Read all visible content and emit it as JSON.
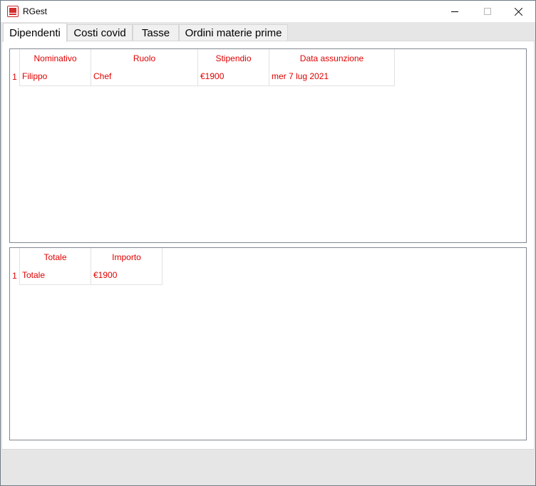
{
  "window": {
    "title": "RGest",
    "icon": "app-icon"
  },
  "tabs": [
    {
      "label": "Dipendenti",
      "active": true
    },
    {
      "label": "Costi covid",
      "active": false
    },
    {
      "label": "Tasse",
      "active": false
    },
    {
      "label": "Ordini materie prime",
      "active": false
    }
  ],
  "employees_table": {
    "columns": [
      "Nominativo",
      "Ruolo",
      "Stipendio",
      "Data assunzione"
    ],
    "rows": [
      {
        "index": "1",
        "cells": [
          "Filippo",
          "Chef",
          "€1900",
          "mer 7 lug 2021"
        ]
      }
    ]
  },
  "totals_table": {
    "columns": [
      "Totale",
      "Importo"
    ],
    "rows": [
      {
        "index": "1",
        "cells": [
          "Totale",
          "€1900"
        ]
      }
    ]
  },
  "colors": {
    "text_accent": "#e00000",
    "tab_strip": "#e6e6e6"
  }
}
